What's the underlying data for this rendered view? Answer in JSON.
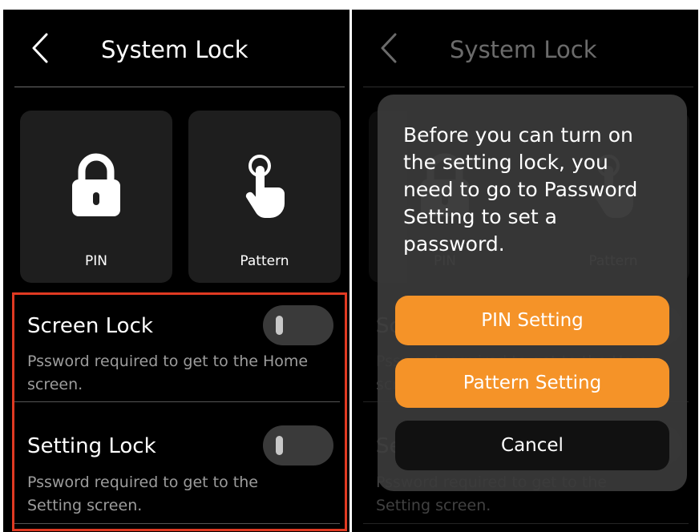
{
  "colors": {
    "background": "#000000",
    "card": "#1e1e1e",
    "accent_orange": "#f59328",
    "highlight_border": "#e03a22",
    "secondary_text": "#9c9c9c",
    "modal": "#3b3b3b"
  },
  "header": {
    "title": "System Lock",
    "back_icon": "chevron-left-icon"
  },
  "lock_types": [
    {
      "label": "PIN",
      "icon": "padlock-icon"
    },
    {
      "label": "Pattern",
      "icon": "tap-gesture-icon"
    }
  ],
  "settings": [
    {
      "title": "Screen Lock",
      "description": "Pssword required to get to the Home screen.",
      "enabled": false
    },
    {
      "title": "Setting Lock",
      "description": "Pssword required to get to the Setting screen.",
      "enabled": false
    }
  ],
  "dialog": {
    "message": "Before you can turn on the setting lock, you need to go to Password Setting to set a password.",
    "buttons": {
      "pin": "PIN Setting",
      "pattern": "Pattern Setting",
      "cancel": "Cancel"
    }
  }
}
